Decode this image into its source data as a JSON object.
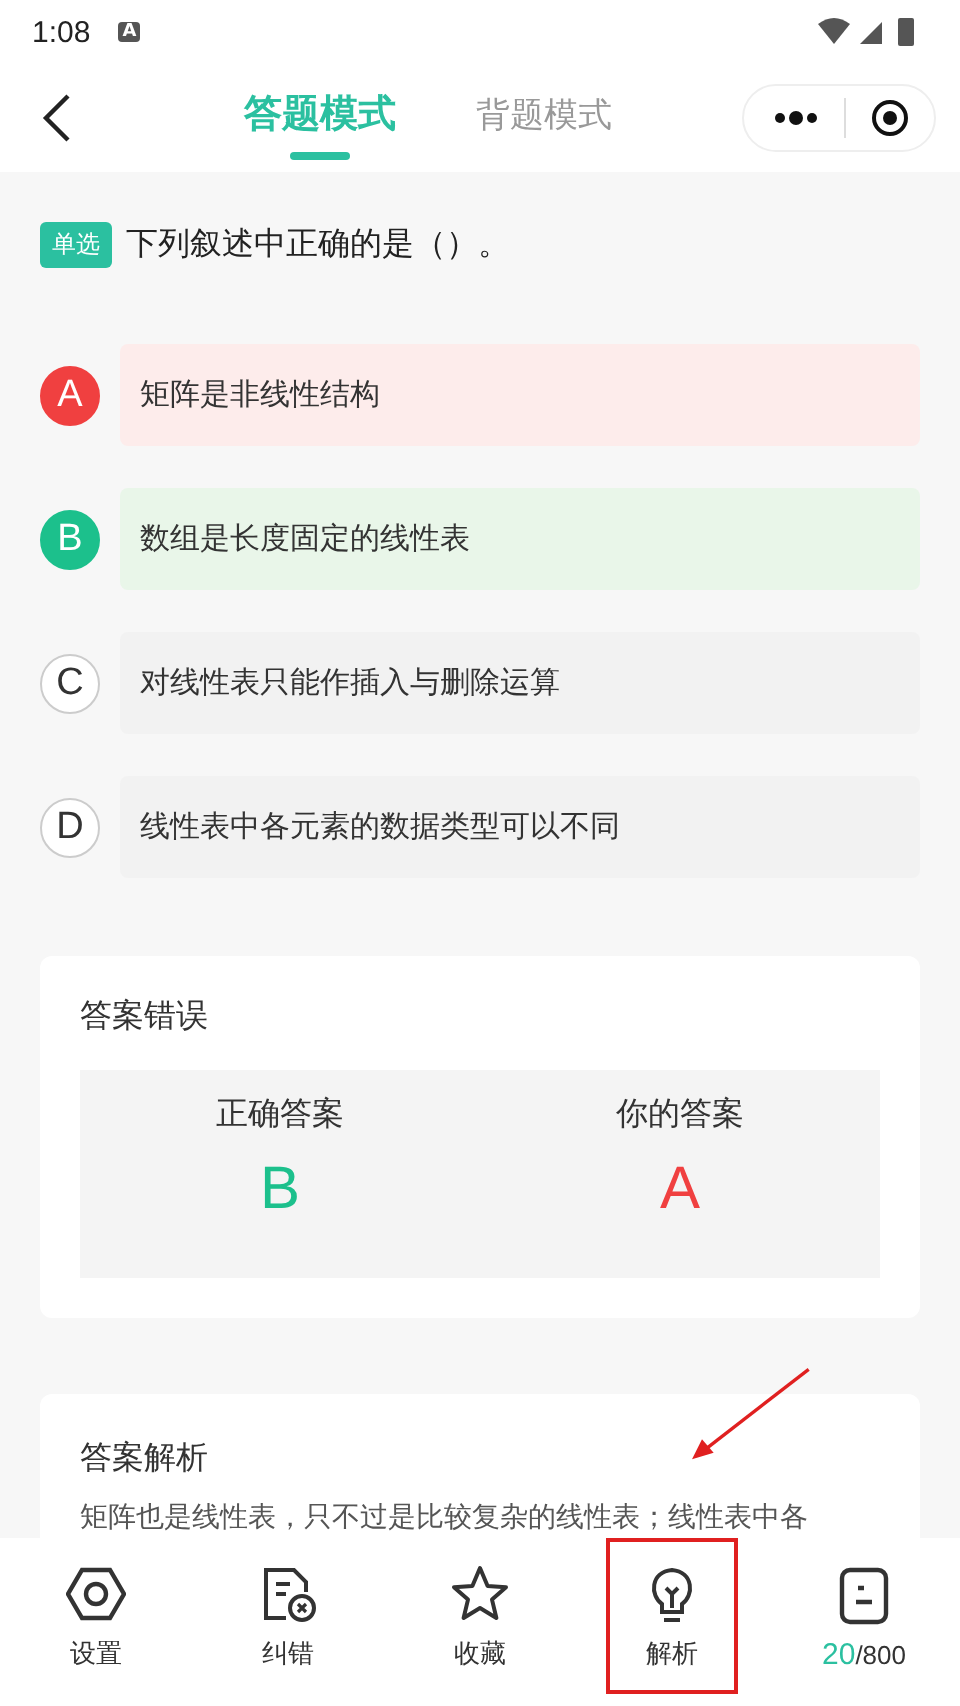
{
  "status_bar": {
    "time": "1:08",
    "notification": "A"
  },
  "header": {
    "tabs": [
      {
        "label": "答题模式",
        "selected": true
      },
      {
        "label": "背题模式",
        "selected": false
      }
    ]
  },
  "question": {
    "tag": "单选",
    "text": "下列叙述中正确的是（）。"
  },
  "options": [
    {
      "letter": "A",
      "text": "矩阵是非线性结构",
      "selected": true,
      "correct": false
    },
    {
      "letter": "B",
      "text": "数组是长度固定的线性表",
      "selected": false,
      "correct": true
    },
    {
      "letter": "C",
      "text": "对线性表只能作插入与删除运算",
      "selected": false,
      "correct": false
    },
    {
      "letter": "D",
      "text": "线性表中各元素的数据类型可以不同",
      "selected": false,
      "correct": false
    }
  ],
  "result": {
    "title": "答案错误",
    "columns": [
      {
        "label": "正确答案",
        "answer": "B",
        "correct": true
      },
      {
        "label": "你的答案",
        "answer": "A",
        "correct": false
      }
    ]
  },
  "explanation": {
    "title": "答案解析",
    "text": "矩阵也是线性表，只不过是比较复杂的线性表；线性表中各"
  },
  "bottom_nav": [
    {
      "kind": "settings",
      "label": "设置",
      "highlighted": false
    },
    {
      "kind": "report",
      "label": "纠错",
      "highlighted": false
    },
    {
      "kind": "star",
      "label": "收藏",
      "highlighted": false
    },
    {
      "kind": "bulb",
      "label": "解析",
      "highlighted": true
    },
    {
      "kind": "progress",
      "current": "20",
      "total": "/800",
      "highlighted": false
    }
  ]
}
